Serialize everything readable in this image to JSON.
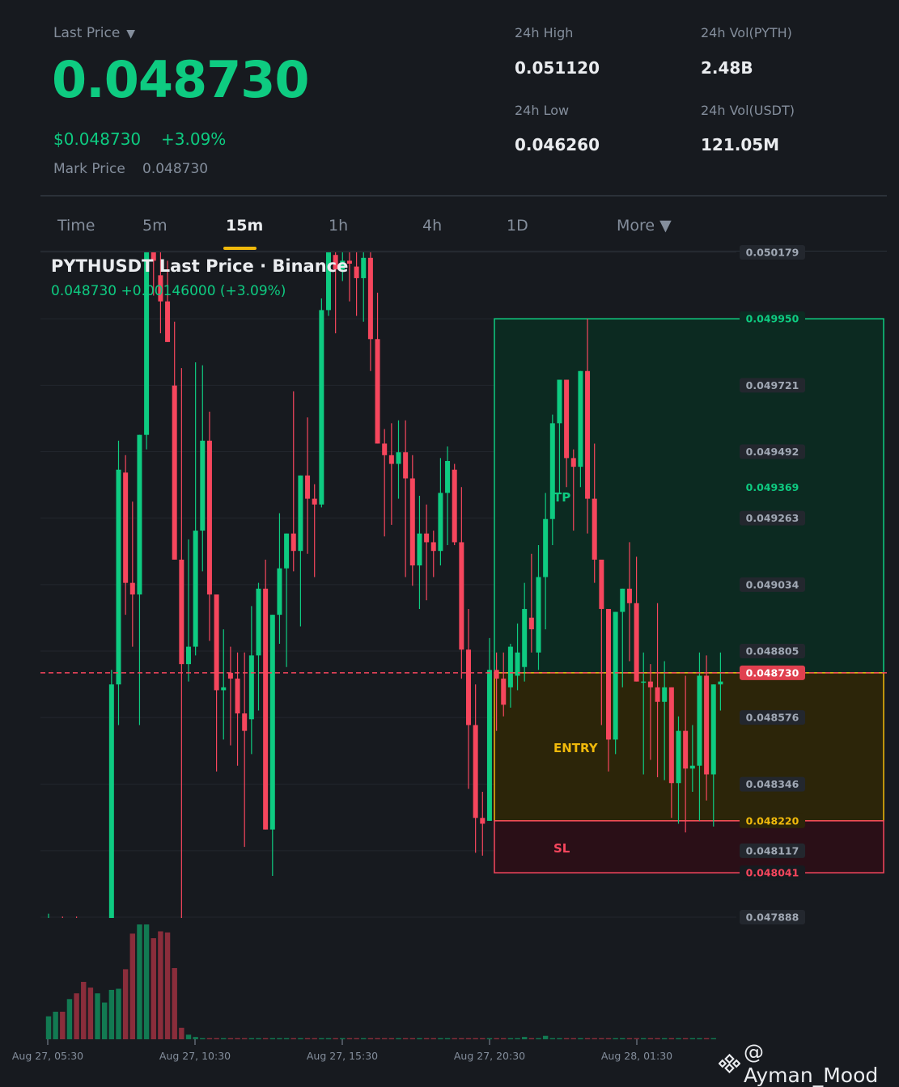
{
  "header": {
    "last_price_label": "Last Price",
    "last_price": "0.048730",
    "usd_price": "$0.048730",
    "change_pct": "+3.09%",
    "mark_price_label": "Mark Price",
    "mark_price": "0.048730",
    "stats": {
      "high_label": "24h High",
      "high_value": "0.051120",
      "low_label": "24h Low",
      "low_value": "0.046260",
      "vol_base_label": "24h Vol(PYTH)",
      "vol_base_value": "2.48B",
      "vol_quote_label": "24h Vol(USDT)",
      "vol_quote_value": "121.05M"
    }
  },
  "tabs": {
    "time": "Time",
    "m5": "5m",
    "m15": "15m",
    "h1": "1h",
    "h4": "4h",
    "d1": "1D",
    "more": "More ▼"
  },
  "chart": {
    "title": "PYTHUSDT Last Price · Binance",
    "subtitle": "0.048730  +0.00146000 (+3.09%)",
    "colors": {
      "up": "#0ecb81",
      "down": "#f6465d",
      "tp": "#0ecb81",
      "entry": "#f0b90b",
      "sl": "#f6465d"
    }
  },
  "chart_data": {
    "type": "candlestick",
    "symbol": "PYTHUSDT",
    "interval": "15m",
    "ylim": [
      0.047888,
      0.050179
    ],
    "y_ticks": [
      "0.050179",
      "0.049950",
      "0.049721",
      "0.049492",
      "0.049263",
      "0.049034",
      "0.048805",
      "0.048576",
      "0.048346",
      "0.048117",
      "0.047888"
    ],
    "x_ticks": [
      "Aug 27, 05:30",
      "Aug 27, 10:30",
      "Aug 27, 15:30",
      "Aug 27, 20:30",
      "Aug 28, 01:30"
    ],
    "last_price": 0.04873,
    "position": {
      "tp": {
        "label": "TP",
        "price": 0.04995
      },
      "entry": {
        "label": "ENTRY",
        "price": 0.04822
      },
      "sl": {
        "label": "SL",
        "price": 0.048041
      },
      "tp_mid_label": "0.049369",
      "tp_label_text": "0.049950",
      "entry_label_text": "0.048220",
      "sl_label_text": "0.048041",
      "last_label_text": "0.048730"
    },
    "candles": [
      [
        0.04788,
        0.0479,
        0.04786,
        0.04788
      ],
      [
        0.04786,
        0.04788,
        0.04784,
        0.04786
      ],
      [
        0.04787,
        0.04789,
        0.04785,
        0.04786
      ],
      [
        0.04786,
        0.04788,
        0.04784,
        0.04787
      ],
      [
        0.04787,
        0.04789,
        0.04785,
        0.04786
      ],
      [
        0.04786,
        0.04787,
        0.04784,
        0.04785
      ],
      [
        0.04785,
        0.04786,
        0.04783,
        0.04784
      ],
      [
        0.04784,
        0.04785,
        0.04783,
        0.04784
      ],
      [
        0.04784,
        0.04786,
        0.04782,
        0.04785
      ],
      [
        0.04785,
        0.04874,
        0.04782,
        0.04869
      ],
      [
        0.04869,
        0.04953,
        0.04855,
        0.04943
      ],
      [
        0.04942,
        0.04948,
        0.04893,
        0.04904
      ],
      [
        0.04904,
        0.04932,
        0.04882,
        0.049
      ],
      [
        0.049,
        0.04943,
        0.04855,
        0.04955
      ],
      [
        0.04955,
        0.05025,
        0.0495,
        0.05018
      ],
      [
        0.05018,
        0.05022,
        0.05003,
        0.05015
      ],
      [
        0.0501,
        0.05018,
        0.0499,
        0.05001
      ],
      [
        0.05001,
        0.05015,
        0.04997,
        0.04987
      ],
      [
        0.04972,
        0.04994,
        0.04934,
        0.04912
      ],
      [
        0.04912,
        0.04978,
        0.04776,
        0.04876
      ],
      [
        0.04876,
        0.04919,
        0.0487,
        0.04882
      ],
      [
        0.04882,
        0.0498,
        0.04879,
        0.04922
      ],
      [
        0.04922,
        0.04979,
        0.04908,
        0.04953
      ],
      [
        0.04953,
        0.04963,
        0.04884,
        0.049
      ],
      [
        0.049,
        0.0488,
        0.04839,
        0.04867
      ],
      [
        0.04867,
        0.04888,
        0.0485,
        0.04868
      ],
      [
        0.04873,
        0.04882,
        0.04848,
        0.04871
      ],
      [
        0.04871,
        0.0488,
        0.04841,
        0.04859
      ],
      [
        0.04859,
        0.0488,
        0.04813,
        0.04853
      ],
      [
        0.04857,
        0.04896,
        0.04845,
        0.04879
      ],
      [
        0.04879,
        0.04904,
        0.0486,
        0.04902
      ],
      [
        0.04902,
        0.04912,
        0.0484,
        0.04819
      ],
      [
        0.04819,
        0.04877,
        0.04803,
        0.04893
      ],
      [
        0.04893,
        0.04928,
        0.04883,
        0.04909
      ],
      [
        0.04909,
        0.0492,
        0.04875,
        0.04921
      ],
      [
        0.04921,
        0.0497,
        0.04908,
        0.04915
      ],
      [
        0.04915,
        0.0494,
        0.04889,
        0.04941
      ],
      [
        0.04941,
        0.04961,
        0.04914,
        0.04933
      ],
      [
        0.04933,
        0.04938,
        0.04906,
        0.04931
      ],
      [
        0.04931,
        0.05002,
        0.0493,
        0.04998
      ],
      [
        0.04998,
        0.0502,
        0.04996,
        0.0502
      ],
      [
        0.05017,
        0.0504,
        0.0499,
        0.05012
      ],
      [
        0.05012,
        0.05022,
        0.05008,
        0.05015
      ],
      [
        0.05015,
        0.05035,
        0.05001,
        0.05014
      ],
      [
        0.05013,
        0.05022,
        0.04996,
        0.05009
      ],
      [
        0.05009,
        0.05021,
        0.04994,
        0.05016
      ],
      [
        0.05016,
        0.05022,
        0.04977,
        0.04988
      ],
      [
        0.04988,
        0.05004,
        0.04966,
        0.04952
      ],
      [
        0.04952,
        0.04957,
        0.0492,
        0.04948
      ],
      [
        0.04948,
        0.04959,
        0.04924,
        0.04945
      ],
      [
        0.04945,
        0.0496,
        0.04933,
        0.04949
      ],
      [
        0.04949,
        0.0496,
        0.04906,
        0.0494
      ],
      [
        0.0494,
        0.04948,
        0.04903,
        0.0491
      ],
      [
        0.0491,
        0.04934,
        0.04895,
        0.04921
      ],
      [
        0.04921,
        0.04931,
        0.04898,
        0.04918
      ],
      [
        0.04918,
        0.04922,
        0.04906,
        0.04915
      ],
      [
        0.04915,
        0.04947,
        0.0491,
        0.04935
      ],
      [
        0.04935,
        0.04951,
        0.04917,
        0.04946
      ],
      [
        0.04943,
        0.04945,
        0.04917,
        0.04918
      ],
      [
        0.04918,
        0.04937,
        0.04871,
        0.04881
      ],
      [
        0.04881,
        0.04895,
        0.04833,
        0.04855
      ],
      [
        0.04855,
        0.04869,
        0.04811,
        0.04823
      ],
      [
        0.04823,
        0.04832,
        0.0481,
        0.04821
      ],
      [
        0.04822,
        0.04885,
        0.04822,
        0.04874
      ],
      [
        0.04874,
        0.0488,
        0.04853,
        0.04871
      ],
      [
        0.04871,
        0.0488,
        0.04858,
        0.04862
      ],
      [
        0.04868,
        0.04883,
        0.04861,
        0.04882
      ],
      [
        0.04872,
        0.0489,
        0.04867,
        0.0488
      ],
      [
        0.04875,
        0.04904,
        0.0487,
        0.04895
      ],
      [
        0.04892,
        0.04914,
        0.0488,
        0.04888
      ],
      [
        0.0488,
        0.04917,
        0.04874,
        0.04906
      ],
      [
        0.04906,
        0.04935,
        0.04888,
        0.04926
      ],
      [
        0.04926,
        0.04962,
        0.04917,
        0.04959
      ],
      [
        0.04959,
        0.04967,
        0.04935,
        0.04974
      ],
      [
        0.04974,
        0.04962,
        0.04937,
        0.04947
      ],
      [
        0.04947,
        0.0495,
        0.04922,
        0.04944
      ],
      [
        0.04944,
        0.04975,
        0.04937,
        0.04977
      ],
      [
        0.04977,
        0.04995,
        0.04921,
        0.04933
      ],
      [
        0.04933,
        0.04952,
        0.04904,
        0.04912
      ],
      [
        0.04912,
        0.04893,
        0.04855,
        0.04895
      ],
      [
        0.04895,
        0.04893,
        0.04839,
        0.0485
      ],
      [
        0.0485,
        0.04892,
        0.04845,
        0.04894
      ],
      [
        0.04894,
        0.04902,
        0.04868,
        0.04902
      ],
      [
        0.04902,
        0.04918,
        0.04877,
        0.04897
      ],
      [
        0.04897,
        0.04913,
        0.0488,
        0.0487
      ],
      [
        0.0487,
        0.0488,
        0.04838,
        0.0487
      ],
      [
        0.0487,
        0.04876,
        0.04843,
        0.04868
      ],
      [
        0.04868,
        0.04897,
        0.04837,
        0.04863
      ],
      [
        0.04863,
        0.04877,
        0.04836,
        0.04868
      ],
      [
        0.04868,
        0.04865,
        0.04823,
        0.04835
      ],
      [
        0.04835,
        0.04858,
        0.04821,
        0.04853
      ],
      [
        0.04853,
        0.04872,
        0.04818,
        0.0484
      ],
      [
        0.0484,
        0.04855,
        0.04832,
        0.04841
      ],
      [
        0.04841,
        0.0488,
        0.04822,
        0.04872
      ],
      [
        0.04872,
        0.04879,
        0.04829,
        0.04838
      ],
      [
        0.04838,
        0.04868,
        0.0482,
        0.04869
      ],
      [
        0.04869,
        0.0488,
        0.0486,
        0.0487
      ]
    ],
    "volumes": [
      2,
      2.4,
      2.4,
      3.5,
      4,
      5,
      4.5,
      4,
      3.2,
      4.3,
      4.4,
      6.1,
      9.2,
      10,
      10,
      8.8,
      9.4,
      9.3,
      6.2,
      1,
      0.4,
      0.2,
      0.1,
      0.1,
      0.1,
      0.1,
      0.1,
      0.1,
      0.1,
      0.1,
      0.1,
      0.1,
      0.1,
      0.1,
      0.1,
      0.1,
      0.1,
      0.1,
      0.1,
      0.1,
      0.1,
      0.1,
      0.1,
      0.1,
      0.1,
      0.1,
      0.1,
      0.1,
      0.1,
      0.1,
      0.1,
      0.1,
      0.1,
      0.1,
      0.1,
      0.1,
      0.1,
      0.1,
      0.1,
      0.1,
      0.1,
      0.1,
      0.1,
      0.1,
      0.1,
      0.1,
      0.1,
      0.1,
      0.2,
      0.1,
      0.1,
      0.3,
      0.1,
      0.1,
      0.1,
      0.1,
      0.1,
      0.1,
      0.1,
      0.1,
      0.1,
      0.1,
      0.1,
      0.1,
      0.1,
      0.1,
      0.1,
      0.1,
      0.1,
      0.1,
      0.1,
      0.1,
      0.1,
      0.1,
      0.1,
      0.1
    ]
  },
  "watermark": {
    "text": "@ Ayman_Mood",
    "icon": "binance-logo-icon"
  }
}
